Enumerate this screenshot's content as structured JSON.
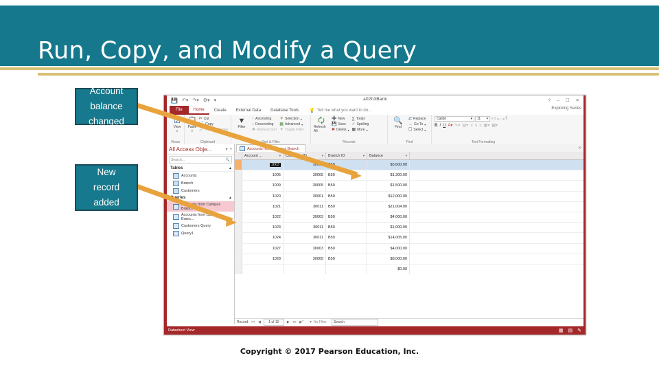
{
  "slide": {
    "title": "Run, Copy, and Modify a Query",
    "copyright": "Copyright © 2017 Pearson Education, Inc.",
    "accent_teal": "#15788c",
    "accent_gold": "#d8c176",
    "callout_fill": "#17798d",
    "callout_border": "#1b4a57",
    "arrow_color": "#e8a33d"
  },
  "callouts": [
    {
      "id": "balance",
      "line1": "Account",
      "line2": "balance",
      "line3": "changed"
    },
    {
      "id": "record",
      "line1": "New",
      "line2": "record",
      "line3": "added"
    }
  ],
  "access": {
    "window_title": "a02h3Bank",
    "user_label": "Exploring Series",
    "quick_access": [
      "save-icon",
      "undo-icon",
      "redo-icon",
      "customize-icon"
    ],
    "window_controls": [
      "help-icon",
      "minimize-icon",
      "restore-icon",
      "close-icon"
    ],
    "tabs": [
      {
        "label": "File",
        "type": "file"
      },
      {
        "label": "Home",
        "type": "tab",
        "active": true
      },
      {
        "label": "Create",
        "type": "tab",
        "active": false
      },
      {
        "label": "External Data",
        "type": "tab",
        "active": false
      },
      {
        "label": "Database Tools",
        "type": "tab",
        "active": false
      }
    ],
    "tell_me": "Tell me what you want to do...",
    "ribbon": {
      "groups": [
        {
          "label": "Views",
          "big": [
            {
              "label": "View",
              "icon": "view-icon"
            }
          ]
        },
        {
          "label": "Clipboard",
          "big": [
            {
              "label": "Paste",
              "icon": "paste-icon"
            }
          ],
          "small": [
            {
              "label": "Cut",
              "icon": "cut-icon"
            },
            {
              "label": "Copy",
              "icon": "copy-icon"
            },
            {
              "label": "Format Painter",
              "icon": "format-painter-icon",
              "dim": true
            }
          ]
        },
        {
          "label": "Sort & Filter",
          "big": [
            {
              "label": "Filter",
              "icon": "filter-icon"
            }
          ],
          "small": [
            {
              "label": "Ascending",
              "icon": "sort-asc-icon"
            },
            {
              "label": "Descending",
              "icon": "sort-desc-icon"
            },
            {
              "label": "Remove Sort",
              "icon": "remove-sort-icon",
              "dim": true
            }
          ],
          "small2": [
            {
              "label": "Selection",
              "icon": "selection-icon"
            },
            {
              "label": "Advanced",
              "icon": "advanced-icon"
            },
            {
              "label": "Toggle Filter",
              "icon": "toggle-filter-icon",
              "dim": true
            }
          ]
        },
        {
          "label": "Records",
          "big": [
            {
              "label": "Refresh All",
              "icon": "refresh-icon"
            }
          ],
          "small": [
            {
              "label": "New",
              "icon": "new-record-icon"
            },
            {
              "label": "Save",
              "icon": "save-record-icon"
            },
            {
              "label": "Delete",
              "icon": "delete-record-icon"
            }
          ],
          "small2": [
            {
              "label": "Totals",
              "icon": "totals-icon"
            },
            {
              "label": "Spelling",
              "icon": "spelling-icon"
            },
            {
              "label": "More",
              "icon": "more-icon"
            }
          ]
        },
        {
          "label": "Find",
          "big": [
            {
              "label": "Find",
              "icon": "find-icon"
            }
          ],
          "small": [
            {
              "label": "Replace",
              "icon": "replace-icon"
            },
            {
              "label": "Go To",
              "icon": "goto-icon"
            },
            {
              "label": "Select",
              "icon": "select-icon"
            }
          ]
        },
        {
          "label": "Text Formatting",
          "font_name": "Calibri",
          "font_size": "11"
        }
      ]
    },
    "nav_pane": {
      "title": "All Access Obje...",
      "search_placeholder": "Search...",
      "groups": [
        {
          "name": "Tables",
          "items": [
            {
              "label": "Accounts",
              "icon": "table-icon",
              "selected": false
            },
            {
              "label": "Branch",
              "icon": "table-icon",
              "selected": false
            },
            {
              "label": "Customers",
              "icon": "table-icon",
              "selected": false
            }
          ]
        },
        {
          "name": "Queries",
          "items": [
            {
              "label": "Accounts from Campus Branch",
              "icon": "query-icon",
              "selected": true
            },
            {
              "label": "Accounts from Campus Branc...",
              "icon": "query-icon",
              "selected": false
            },
            {
              "label": "Customers Query",
              "icon": "query-icon",
              "selected": false
            },
            {
              "label": "Query1",
              "icon": "query-icon",
              "selected": false
            }
          ]
        }
      ]
    },
    "document_tab": "Accounts from Campus Branch",
    "datasheet": {
      "columns": [
        "Account ...",
        "Customer ID",
        "Branch ID",
        "Balance"
      ],
      "rows": [
        {
          "account": "1003",
          "customer": "30010",
          "branch": "B50",
          "balance": "$5,600.00",
          "selected": true
        },
        {
          "account": "1005",
          "customer": "30005",
          "branch": "B50",
          "balance": "$1,300.00",
          "selected": false
        },
        {
          "account": "1009",
          "customer": "30005",
          "branch": "B50",
          "balance": "$1,500.00",
          "selected": false
        },
        {
          "account": "1020",
          "customer": "30001",
          "branch": "B50",
          "balance": "$12,000.00",
          "selected": false
        },
        {
          "account": "1021",
          "customer": "30011",
          "branch": "B50",
          "balance": "$21,004.00",
          "selected": false
        },
        {
          "account": "1022",
          "customer": "30003",
          "branch": "B50",
          "balance": "$4,000.00",
          "selected": false
        },
        {
          "account": "1023",
          "customer": "30011",
          "branch": "B50",
          "balance": "$1,000.00",
          "selected": false
        },
        {
          "account": "1024",
          "customer": "30011",
          "branch": "B50",
          "balance": "$14,005.00",
          "selected": false
        },
        {
          "account": "1027",
          "customer": "30003",
          "branch": "B50",
          "balance": "$4,000.00",
          "selected": false
        },
        {
          "account": "1028",
          "customer": "30005",
          "branch": "B50",
          "balance": "$8,000.00",
          "selected": false
        }
      ],
      "new_row_balance": "$0.00"
    },
    "record_nav": {
      "label": "Record:",
      "position": "1 of 10",
      "filter_status": "No Filter",
      "search_placeholder": "Search"
    },
    "status_bar": {
      "view_label": "Datasheet View",
      "view_buttons": [
        "datasheet-view-icon",
        "pivot-view-icon",
        "design-view-icon"
      ]
    }
  }
}
